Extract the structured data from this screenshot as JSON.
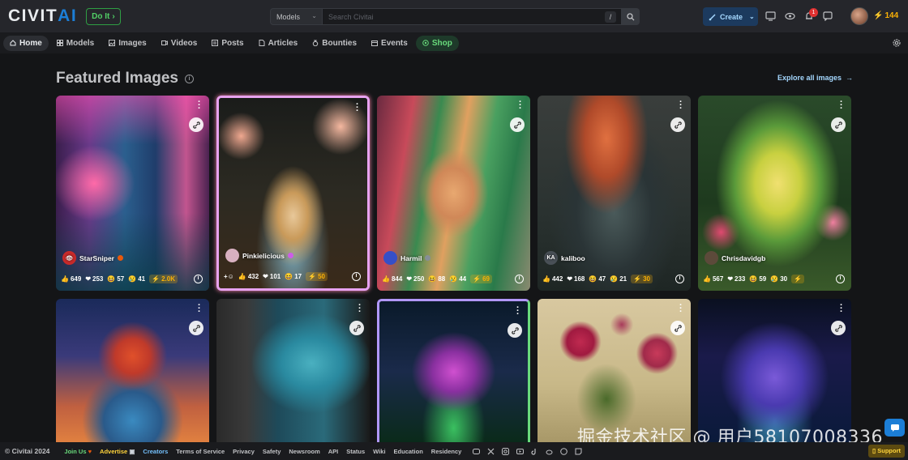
{
  "header": {
    "logo_main": "CIVIT",
    "logo_accent": "AI",
    "doit_label": "Do It",
    "search_type": "Models",
    "search_placeholder": "Search Civitai",
    "search_shortcut": "/",
    "create_label": "Create",
    "notification_count": "1",
    "buzz_amount": "144"
  },
  "nav": {
    "items": [
      {
        "label": "Home",
        "icon": "home-icon"
      },
      {
        "label": "Models",
        "icon": "grid-icon"
      },
      {
        "label": "Images",
        "icon": "image-icon"
      },
      {
        "label": "Videos",
        "icon": "video-icon"
      },
      {
        "label": "Posts",
        "icon": "posts-icon"
      },
      {
        "label": "Articles",
        "icon": "article-icon"
      },
      {
        "label": "Bounties",
        "icon": "moneybag-icon"
      },
      {
        "label": "Events",
        "icon": "calendar-icon"
      },
      {
        "label": "Shop",
        "icon": "shop-icon"
      }
    ]
  },
  "section": {
    "title": "Featured Images",
    "explore_label": "Explore all images"
  },
  "cards": [
    {
      "user": "StarSniper",
      "likes": "649",
      "hearts": "253",
      "laughs": "57",
      "cries": "41",
      "buzz": "2.0K"
    },
    {
      "user": "Pinkielicious",
      "likes": "432",
      "hearts": "101",
      "laughs": "17",
      "cries": "",
      "buzz": "50"
    },
    {
      "user": "Harmil",
      "likes": "844",
      "hearts": "250",
      "laughs": "88",
      "cries": "44",
      "buzz": "69"
    },
    {
      "user": "kaliboo",
      "avatar_text": "KA",
      "likes": "442",
      "hearts": "168",
      "laughs": "47",
      "cries": "21",
      "buzz": "30"
    },
    {
      "user": "Chrisdavidgb",
      "likes": "567",
      "hearts": "233",
      "laughs": "59",
      "cries": "30",
      "buzz": ""
    }
  ],
  "footer": {
    "copyright": "© Civitai 2024",
    "join": "Join Us",
    "advertise": "Advertise",
    "creators": "Creators",
    "links": [
      "Terms of Service",
      "Privacy",
      "Safety",
      "Newsroom",
      "API",
      "Status",
      "Wiki",
      "Education",
      "Residency"
    ],
    "support": "Support"
  },
  "watermark": "掘金技术社区 @ 用户58107008336",
  "colors": {
    "accent": "#1c7ed6",
    "buzz": "#fab005",
    "shop": "#69db7c"
  }
}
